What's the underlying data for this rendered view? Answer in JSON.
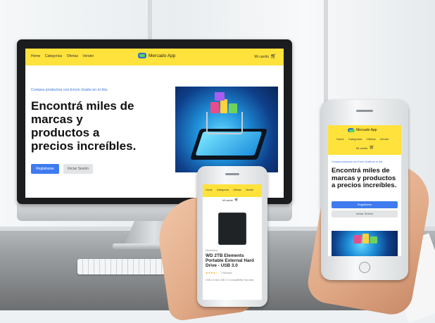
{
  "site": {
    "brand": "Mercado App",
    "nav_links": [
      "Home",
      "Categorías",
      "Ofertas",
      "Vender"
    ],
    "cart_label": "Mi carrito",
    "tagline": "Compra productos con Envío Gratis en el día.",
    "headline": "Encontrá miles de marcas y productos a precios increíbles.",
    "register_button": "Registrarse",
    "login_button": "Iniciar Sesión"
  },
  "product": {
    "title": "WD 2TB Elements Portable External Hard Drive - USB 3.0",
    "category": "Electrónica",
    "reviews": "3 Reviews",
    "description": "USB 3.0 and USB 2.0 Compatibility Fast data",
    "stars": "★★★★☆"
  },
  "icons": {
    "cart": "shopping-cart-icon",
    "logo": "mercado-app-logo-icon"
  },
  "colors": {
    "navbar": "#ffe23b",
    "primary": "#3f7bef",
    "tagline": "#3b74d6"
  }
}
